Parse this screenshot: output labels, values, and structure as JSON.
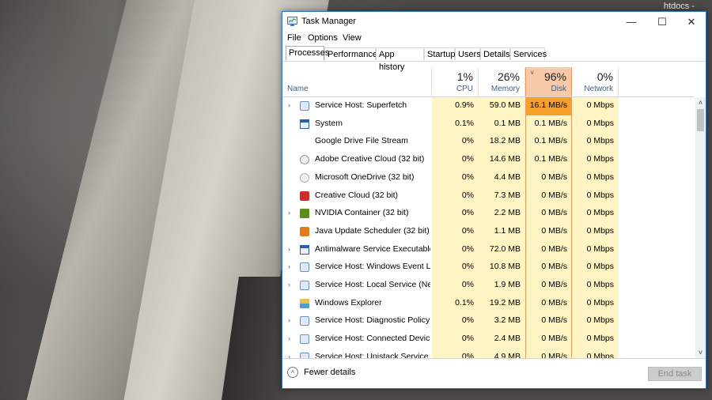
{
  "desktop": {
    "corner_text": "htdocs -"
  },
  "window": {
    "title": "Task Manager",
    "controls": {
      "minimize": "—",
      "maximize": "☐",
      "close": "✕"
    }
  },
  "menu": [
    "File",
    "Options",
    "View"
  ],
  "tabs": [
    "Processes",
    "Performance",
    "App history",
    "Startup",
    "Users",
    "Details",
    "Services"
  ],
  "active_tab": "Processes",
  "columns": {
    "name": {
      "label": "Name"
    },
    "cpu": {
      "pct": "1%",
      "label": "CPU"
    },
    "memory": {
      "pct": "26%",
      "label": "Memory"
    },
    "disk": {
      "pct": "96%",
      "label": "Disk",
      "sort_indicator": "˅"
    },
    "network": {
      "pct": "0%",
      "label": "Network"
    }
  },
  "rows": [
    {
      "expand": "›",
      "icon": "gear-icon",
      "name": "Service Host: Superfetch",
      "cpu": "0.9%",
      "memory": "59.0 MB",
      "disk": "16.1 MB/s",
      "network": "0 Mbps"
    },
    {
      "expand": "",
      "icon": "system-icon",
      "name": "System",
      "cpu": "0.1%",
      "memory": "0.1 MB",
      "disk": "0.1 MB/s",
      "network": "0 Mbps"
    },
    {
      "expand": "",
      "icon": "blank-icon",
      "name": "Google Drive File Stream",
      "cpu": "0%",
      "memory": "18.2 MB",
      "disk": "0.1 MB/s",
      "network": "0 Mbps"
    },
    {
      "expand": "",
      "icon": "creative-cloud-icon",
      "name": "Adobe Creative Cloud (32 bit)",
      "cpu": "0%",
      "memory": "14.6 MB",
      "disk": "0.1 MB/s",
      "network": "0 Mbps"
    },
    {
      "expand": "",
      "icon": "onedrive-icon",
      "name": "Microsoft OneDrive (32 bit)",
      "cpu": "0%",
      "memory": "4.4 MB",
      "disk": "0 MB/s",
      "network": "0 Mbps"
    },
    {
      "expand": "",
      "icon": "cc-icon",
      "name": "Creative Cloud (32 bit)",
      "cpu": "0%",
      "memory": "7.3 MB",
      "disk": "0 MB/s",
      "network": "0 Mbps"
    },
    {
      "expand": "›",
      "icon": "nvidia-icon",
      "name": "NVIDIA Container (32 bit)",
      "cpu": "0%",
      "memory": "2.2 MB",
      "disk": "0 MB/s",
      "network": "0 Mbps"
    },
    {
      "expand": "",
      "icon": "java-icon",
      "name": "Java Update Scheduler (32 bit)",
      "cpu": "0%",
      "memory": "1.1 MB",
      "disk": "0 MB/s",
      "network": "0 Mbps"
    },
    {
      "expand": "›",
      "icon": "system-icon",
      "name": "Antimalware Service Executable",
      "cpu": "0%",
      "memory": "72.0 MB",
      "disk": "0 MB/s",
      "network": "0 Mbps"
    },
    {
      "expand": "›",
      "icon": "gear-icon",
      "name": "Service Host: Windows Event Log",
      "cpu": "0%",
      "memory": "10.8 MB",
      "disk": "0 MB/s",
      "network": "0 Mbps"
    },
    {
      "expand": "›",
      "icon": "gear-icon",
      "name": "Service Host: Local Service (Net...",
      "cpu": "0%",
      "memory": "1.9 MB",
      "disk": "0 MB/s",
      "network": "0 Mbps"
    },
    {
      "expand": "",
      "icon": "explorer-icon",
      "name": "Windows Explorer",
      "cpu": "0.1%",
      "memory": "19.2 MB",
      "disk": "0 MB/s",
      "network": "0 Mbps"
    },
    {
      "expand": "›",
      "icon": "gear-icon",
      "name": "Service Host: Diagnostic Policy ...",
      "cpu": "0%",
      "memory": "3.2 MB",
      "disk": "0 MB/s",
      "network": "0 Mbps"
    },
    {
      "expand": "›",
      "icon": "gear-icon",
      "name": "Service Host: Connected Device...",
      "cpu": "0%",
      "memory": "2.4 MB",
      "disk": "0 MB/s",
      "network": "0 Mbps"
    },
    {
      "expand": "›",
      "icon": "gear-icon",
      "name": "Service Host: Unistack Service G...",
      "cpu": "0%",
      "memory": "4.9 MB",
      "disk": "0 MB/s",
      "network": "0 Mbps"
    }
  ],
  "scrollbar": {
    "up": "˄",
    "down": "˅"
  },
  "footer": {
    "fewer_icon": "˄",
    "fewer_label": "Fewer details",
    "end_task_label": "End task"
  },
  "colors": {
    "accent": "#2b73c9",
    "heat_low": "#fff4c4",
    "heat_high": "#f4a02a",
    "disk_header": "#f7c9a9"
  }
}
